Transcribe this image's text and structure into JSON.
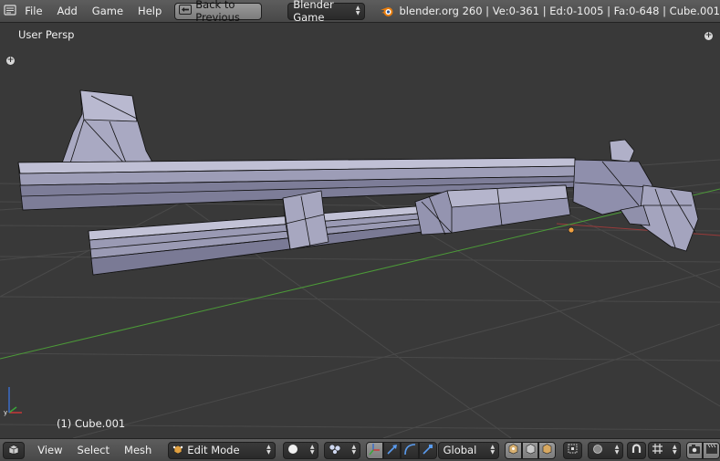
{
  "top_bar": {
    "menus": [
      "File",
      "Add",
      "Game",
      "Help"
    ],
    "back_button_label": "Back to Previous",
    "engine": "Blender Game",
    "stats": "blender.org 260 | Ve:0-361 | Ed:0-1005 | Fa:0-648 | Cube.001"
  },
  "viewport": {
    "view_name": "User Persp",
    "object_label": "(1) Cube.001",
    "colors": {
      "background": "#393939",
      "grid": "#4a4a4a",
      "x_axis": "#9a3a3a",
      "y_axis": "#4c9a38",
      "mesh_face": "#9b9bb4",
      "mesh_edge": "#111111",
      "origin": "#f0a040"
    }
  },
  "bottom_bar": {
    "menus": [
      "View",
      "Select",
      "Mesh"
    ],
    "mode": "Edit Mode",
    "orientation": "Global",
    "icons": {
      "editor_type": "view3d-icon",
      "shading": "solid-sphere-icon",
      "pivot": "pivot-point-icon",
      "manipulator": "manipulator-icon",
      "translate": "translate-arrow-icon",
      "rotate": "rotate-arc-icon",
      "scale": "scale-icon",
      "select_vertex": "vertex-select-icon",
      "select_edge": "edge-select-icon",
      "select_face": "face-select-icon",
      "occlude": "occlude-geometry-icon",
      "proportional": "proportional-edit-icon",
      "snap": "magnet-icon",
      "snap_element": "snap-increment-icon",
      "render": "camera-icon",
      "render_anim": "clapper-icon"
    }
  }
}
